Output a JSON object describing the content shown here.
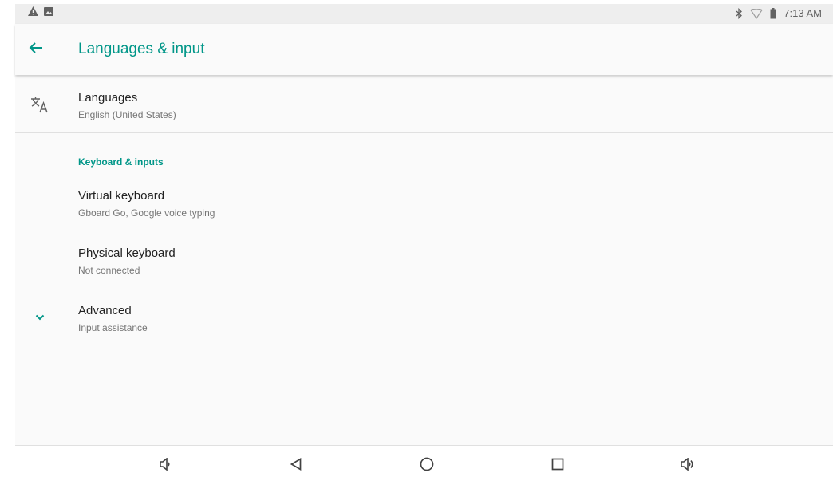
{
  "status_bar": {
    "time": "7:13 AM",
    "left_icons": [
      "warning-icon",
      "image-icon"
    ],
    "right_icons": [
      "bluetooth-icon",
      "wifi-icon",
      "battery-icon"
    ]
  },
  "app_bar": {
    "title": "Languages & input",
    "back_icon": "arrow-back-icon"
  },
  "languages": {
    "title": "Languages",
    "summary": "English (United States)",
    "icon": "translate-icon"
  },
  "keyboard_category": {
    "title": "Keyboard & inputs",
    "items": [
      {
        "title": "Virtual keyboard",
        "summary": "Gboard Go, Google voice typing"
      },
      {
        "title": "Physical keyboard",
        "summary": "Not connected"
      }
    ]
  },
  "advanced": {
    "title": "Advanced",
    "summary": "Input assistance",
    "icon": "chevron-down-icon"
  },
  "nav_bar": {
    "buttons": [
      "volume-down-icon",
      "back-icon",
      "home-icon",
      "recents-icon",
      "volume-up-icon"
    ]
  },
  "colors": {
    "accent": "#009688",
    "title_text": "#212121",
    "summary_text": "#757575",
    "status_bar_bg": "#eeeeee"
  }
}
